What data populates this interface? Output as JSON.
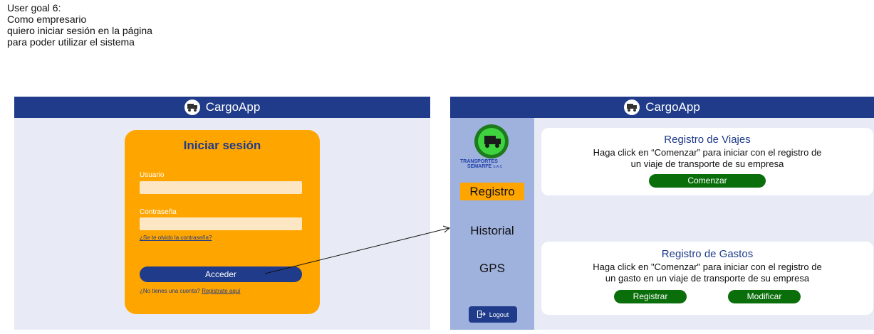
{
  "goal": {
    "lines": [
      "User goal 6:",
      "Como empresario",
      "quiero iniciar sesión en la página",
      "para poder utilizar el sistema"
    ]
  },
  "app_title": "CargoApp",
  "login": {
    "title": "Iniciar sesión",
    "user_label": "Usuario",
    "user_value": "",
    "password_label": "Contraseña",
    "password_value": "",
    "forgot": "¿Se te olvido la contraseña?",
    "submit": "Acceder",
    "no_account": "¿No tienes una cuenta?",
    "register_link": "Registrate aquí"
  },
  "sidebar": {
    "logo_text_1": "TRANSPORTES",
    "logo_text_2": "SEMARFE",
    "logo_text_3": "S.A.C",
    "items": [
      "Registro",
      "Historial",
      "GPS"
    ],
    "active": "Registro",
    "logout": "Logout"
  },
  "cards": {
    "viajes": {
      "title": "Registro de Viajes",
      "line1": "Haga click en “Comenzar” para iniciar con el registro de",
      "line2": "un viaje de transporte de su empresa",
      "button": "Comenzar"
    },
    "gastos": {
      "title": "Registro de Gastos",
      "line1": "Haga click en \"Comenzar\" para iniciar con el registro de",
      "line2": "un gasto en un viaje de transporte de su empresa",
      "button1": "Registrar",
      "button2": "Modificar"
    }
  },
  "colors": {
    "navy": "#1f3b8a",
    "orange": "#ffa500",
    "green": "#0a6e0a",
    "sidebar": "#9fb1dd",
    "panel": "#e8ebf6"
  }
}
